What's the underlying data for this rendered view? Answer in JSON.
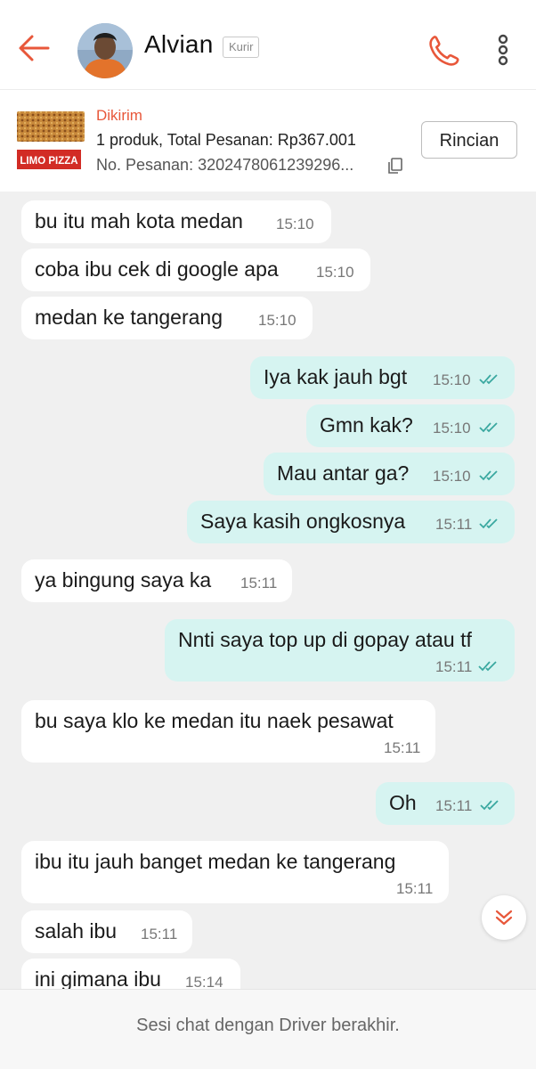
{
  "header": {
    "contact_name": "Alvian",
    "role_badge": "Kurir",
    "icons": {
      "back": "arrow-left-icon",
      "call": "phone-icon",
      "more": "more-vertical-icon"
    },
    "accent_color": "#e8573a"
  },
  "order": {
    "status": "Dikirim",
    "summary": "1 produk, Total Pesanan: Rp367.001",
    "number": "No. Pesanan: 3202478061239296...",
    "details_button": "Rincian",
    "thumbnail_brand": "LIMO PIZZA"
  },
  "messages": [
    {
      "dir": "in",
      "text": "bu itu mah kota medan",
      "time": "15:10"
    },
    {
      "dir": "in",
      "text": "coba ibu cek di google apa",
      "time": "15:10"
    },
    {
      "dir": "in",
      "text": "medan ke tangerang",
      "time": "15:10"
    },
    {
      "dir": "out",
      "text": "Iya kak jauh bgt",
      "time": "15:10",
      "read": true
    },
    {
      "dir": "out",
      "text": "Gmn kak?",
      "time": "15:10",
      "read": true
    },
    {
      "dir": "out",
      "text": "Mau antar ga?",
      "time": "15:10",
      "read": true
    },
    {
      "dir": "out",
      "text": "Saya kasih ongkosnya",
      "time": "15:11",
      "read": true
    },
    {
      "dir": "in",
      "text": "ya bingung saya ka",
      "time": "15:11"
    },
    {
      "dir": "out",
      "text": "Nnti saya top up di gopay atau tf",
      "time": "15:11",
      "read": true
    },
    {
      "dir": "in",
      "text": "bu saya klo ke medan itu naek pesawat",
      "time": "15:11"
    },
    {
      "dir": "out",
      "text": "Oh",
      "time": "15:11",
      "read": true
    },
    {
      "dir": "in",
      "text": "ibu itu jauh banget medan ke tangerang",
      "time": "15:11"
    },
    {
      "dir": "in",
      "text": "salah ibu",
      "time": "15:11"
    },
    {
      "dir": "in",
      "text": "ini gimana ibu",
      "time": "15:14"
    }
  ],
  "footer": {
    "notice": "Sesi chat dengan Driver berakhir."
  },
  "colors": {
    "incoming_bubble": "#ffffff",
    "outgoing_bubble": "#d6f4f1",
    "read_ticks": "#3aa8a0",
    "background": "#f0f0f0"
  }
}
